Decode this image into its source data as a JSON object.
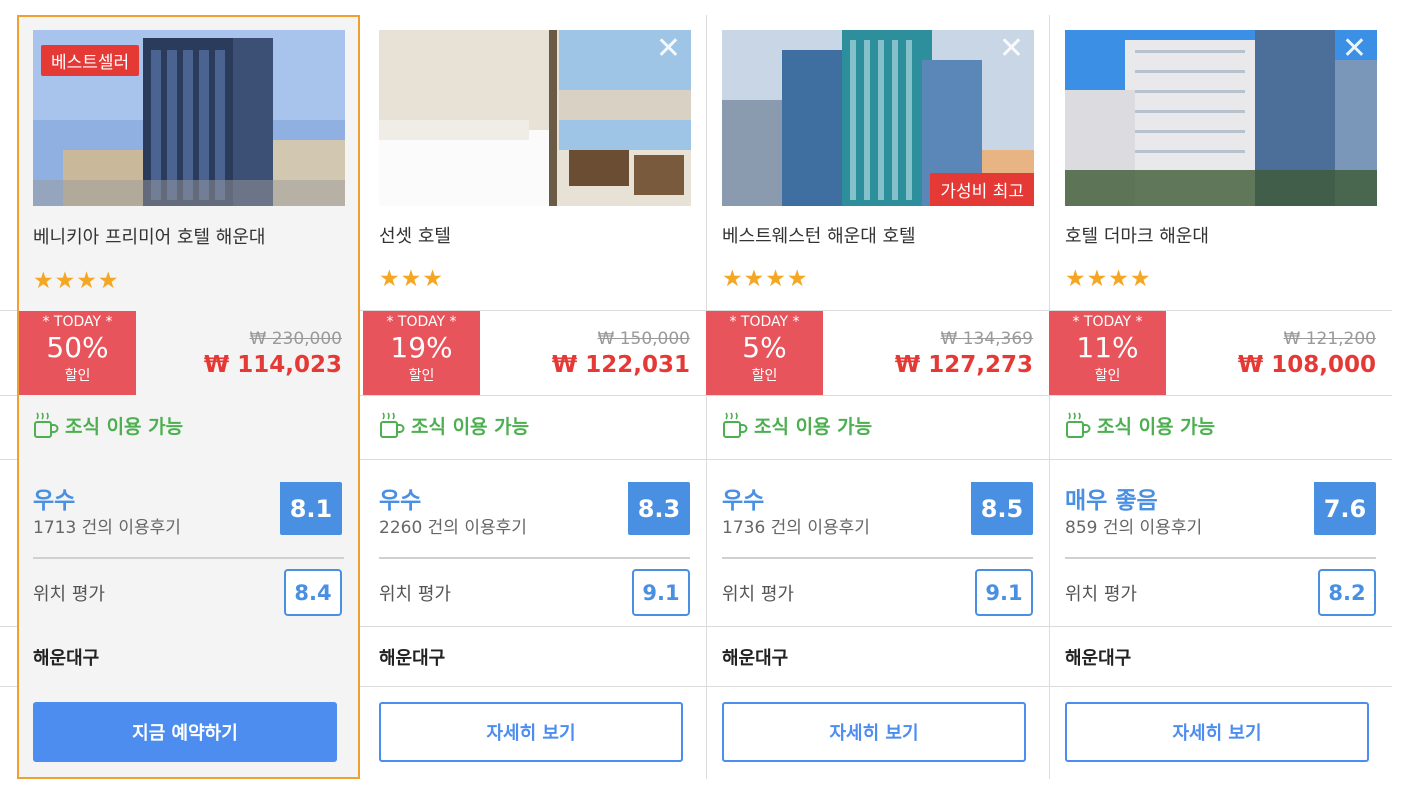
{
  "hotels": [
    {
      "badge_top": "베스트셀러",
      "badge_bottom": "",
      "show_close": false,
      "name": "베니키아 프리미어 호텔 해운대",
      "stars": "★★★★",
      "today_label": "* TODAY *",
      "discount": "50%",
      "discount_suffix": "할인",
      "old_price": "₩ 230,000",
      "new_price": "₩ 114,023",
      "breakfast": "조식 이용 가능",
      "rating_word": "우수",
      "review_count": "1713 건의 이용후기",
      "score": "8.1",
      "location_label": "위치 평가",
      "location_score": "8.4",
      "district": "해운대구",
      "button": "지금 예약하기"
    },
    {
      "badge_top": "",
      "badge_bottom": "",
      "show_close": true,
      "name": "선셋 호텔",
      "stars": "★★★",
      "today_label": "* TODAY *",
      "discount": "19%",
      "discount_suffix": "할인",
      "old_price": "₩ 150,000",
      "new_price": "₩ 122,031",
      "breakfast": "조식 이용 가능",
      "rating_word": "우수",
      "review_count": "2260 건의 이용후기",
      "score": "8.3",
      "location_label": "위치 평가",
      "location_score": "9.1",
      "district": "해운대구",
      "button": "자세히 보기"
    },
    {
      "badge_top": "",
      "badge_bottom": "가성비 최고",
      "show_close": true,
      "name": "베스트웨스턴 해운대 호텔",
      "stars": "★★★★",
      "today_label": "* TODAY *",
      "discount": "5%",
      "discount_suffix": "할인",
      "old_price": "₩ 134,369",
      "new_price": "₩ 127,273",
      "breakfast": "조식 이용 가능",
      "rating_word": "우수",
      "review_count": "1736 건의 이용후기",
      "score": "8.5",
      "location_label": "위치 평가",
      "location_score": "9.1",
      "district": "해운대구",
      "button": "자세히 보기"
    },
    {
      "badge_top": "",
      "badge_bottom": "",
      "show_close": true,
      "name": "호텔 더마크 해운대",
      "stars": "★★★★",
      "today_label": "* TODAY *",
      "discount": "11%",
      "discount_suffix": "할인",
      "old_price": "₩ 121,200",
      "new_price": "₩ 108,000",
      "breakfast": "조식 이용 가능",
      "rating_word": "매우 좋음",
      "review_count": "859 건의 이용후기",
      "score": "7.6",
      "location_label": "위치 평가",
      "location_score": "8.2",
      "district": "해운대구",
      "button": "자세히 보기"
    }
  ],
  "icons": {
    "close": "close-icon",
    "breakfast": "coffee-cup-icon",
    "star": "star-icon"
  },
  "colors": {
    "accent_red": "#e53935",
    "discount_bg": "#e8545b",
    "blue": "#4a90e2",
    "green": "#4caf50",
    "star": "#f5a623",
    "selected_border": "#f0a030"
  }
}
